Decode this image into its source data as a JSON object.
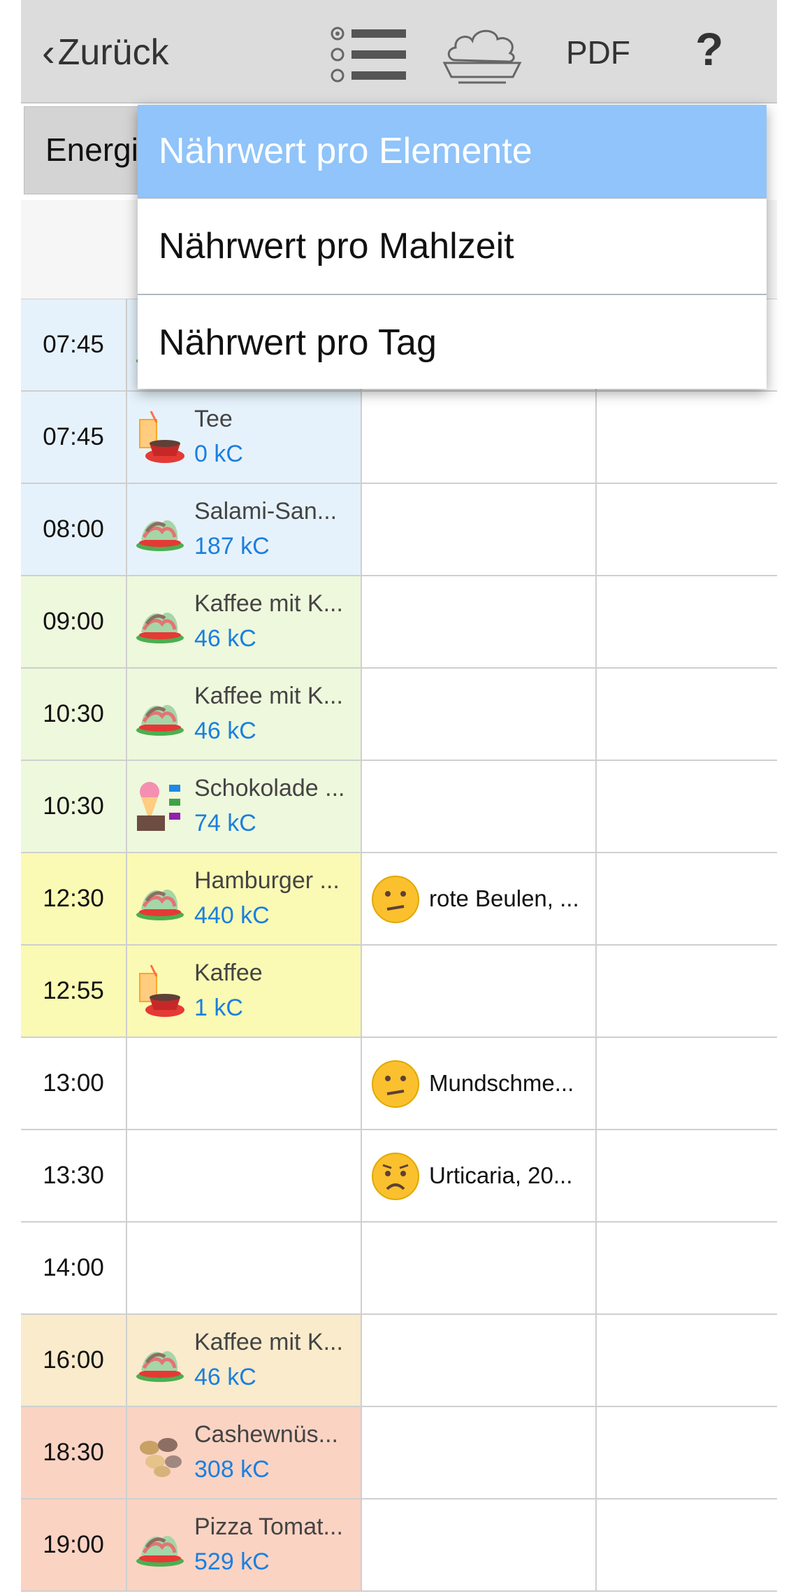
{
  "topbar": {
    "back_label": "Zurück",
    "pdf_label": "PDF",
    "help_label": "?",
    "list_icon": "list-view-icon",
    "meal_icon": "meal-bowl-icon"
  },
  "header": {
    "energy_label": "Energi"
  },
  "dropdown": {
    "items": [
      {
        "label": "Nährwert pro Elemente",
        "selected": true
      },
      {
        "label": "Nährwert pro Mahlzeit",
        "selected": false
      },
      {
        "label": "Nährwert pro Tag",
        "selected": false
      }
    ]
  },
  "colors": {
    "breakfast": "#e6f2fb",
    "morning": "#eef8dc",
    "lunch": "#fafab4",
    "afternoon": "#f9ebcb",
    "evening": "#fbd3c3",
    "kcal": "#1a7fe0",
    "selected_item": "#90c4fa"
  },
  "rows": [
    {
      "time": "07:45",
      "food": "",
      "kc": "",
      "sym": "",
      "icon": "plate-icon",
      "sym_icon": "",
      "bg": "#e6f2fb"
    },
    {
      "time": "07:45",
      "food": "Tee",
      "kc": "0 kC",
      "sym": "",
      "icon": "drink-icon",
      "sym_icon": "",
      "bg": "#e6f2fb"
    },
    {
      "time": "08:00",
      "food": "Salami-San...",
      "kc": "187 kC",
      "sym": "",
      "icon": "plate-icon",
      "sym_icon": "",
      "bg": "#e6f2fb"
    },
    {
      "time": "09:00",
      "food": "Kaffee mit K...",
      "kc": "46 kC",
      "sym": "",
      "icon": "plate-icon",
      "sym_icon": "",
      "bg": "#eef8dc"
    },
    {
      "time": "10:30",
      "food": "Kaffee mit K...",
      "kc": "46 kC",
      "sym": "",
      "icon": "plate-icon",
      "sym_icon": "",
      "bg": "#eef8dc"
    },
    {
      "time": "10:30",
      "food": "Schokolade ...",
      "kc": "74 kC",
      "sym": "",
      "icon": "sweets-icon",
      "sym_icon": "",
      "bg": "#eef8dc"
    },
    {
      "time": "12:30",
      "food": "Hamburger ...",
      "kc": "440 kC",
      "sym": "rote Beulen, ...",
      "icon": "plate-icon",
      "sym_icon": "confused-face-icon",
      "bg": "#fafab4"
    },
    {
      "time": "12:55",
      "food": "Kaffee",
      "kc": "1 kC",
      "sym": "",
      "icon": "drink-icon",
      "sym_icon": "",
      "bg": "#fafab4"
    },
    {
      "time": "13:00",
      "food": "",
      "kc": "",
      "sym": "Mundschme...",
      "icon": "",
      "sym_icon": "confused-face-icon",
      "bg": "#ffffff"
    },
    {
      "time": "13:30",
      "food": "",
      "kc": "",
      "sym": "Urticaria, 20...",
      "icon": "",
      "sym_icon": "worried-face-icon",
      "bg": "#ffffff"
    },
    {
      "time": "14:00",
      "food": "",
      "kc": "",
      "sym": "",
      "icon": "",
      "sym_icon": "",
      "bg": "#ffffff"
    },
    {
      "time": "16:00",
      "food": "Kaffee mit K...",
      "kc": "46 kC",
      "sym": "",
      "icon": "plate-icon",
      "sym_icon": "",
      "bg": "#f9ebcb"
    },
    {
      "time": "18:30",
      "food": "Cashewnüs...",
      "kc": "308 kC",
      "sym": "",
      "icon": "nuts-icon",
      "sym_icon": "",
      "bg": "#fbd3c3"
    },
    {
      "time": "19:00",
      "food": "Pizza Tomat...",
      "kc": "529 kC",
      "sym": "",
      "icon": "plate-icon",
      "sym_icon": "",
      "bg": "#fbd3c3"
    }
  ]
}
